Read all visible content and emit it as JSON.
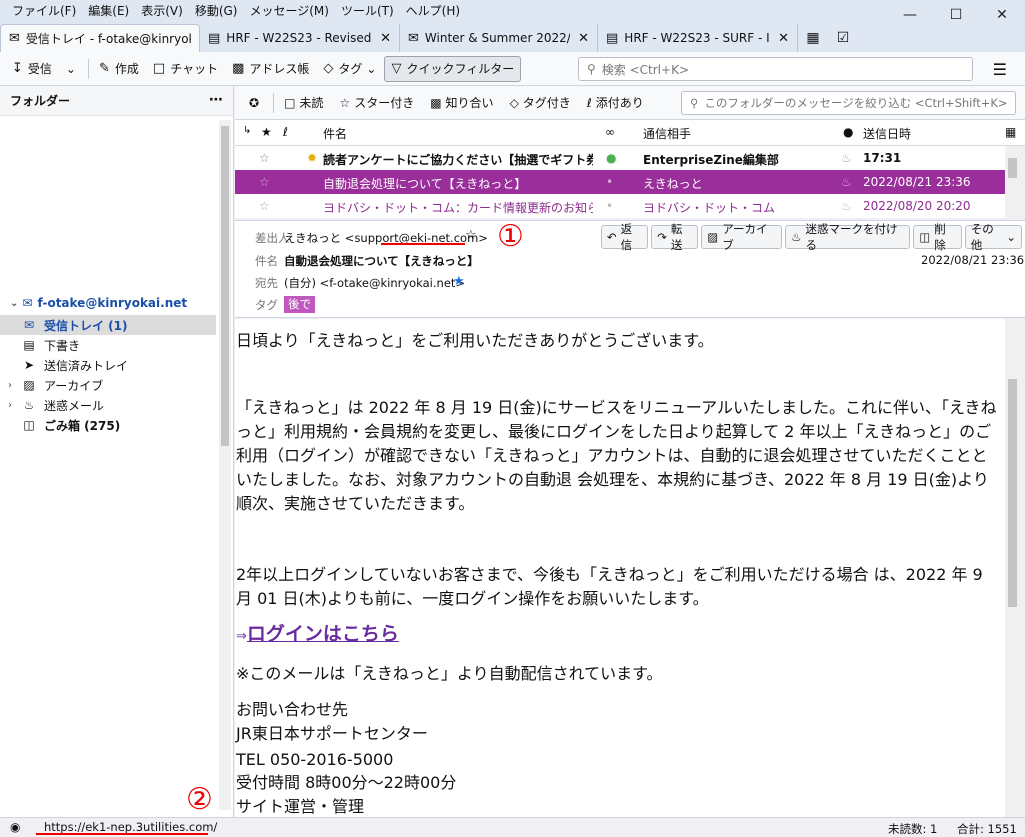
{
  "menu": [
    "ファイル(F)",
    "編集(E)",
    "表示(V)",
    "移動(G)",
    "メッセージ(M)",
    "ツール(T)",
    "ヘルプ(H)"
  ],
  "tabs": [
    {
      "label": "受信トレイ - f-otake@kinryokai",
      "icon": "inbox-icon",
      "active": true
    },
    {
      "label": "HRF - W22S23 - Revised -",
      "icon": "document-icon",
      "active": false
    },
    {
      "label": "Winter & Summer 2022/ 2",
      "icon": "mail-icon",
      "active": false
    },
    {
      "label": "HRF - W22S23 - SURF - IN",
      "icon": "document-icon",
      "active": false
    }
  ],
  "toolbar": {
    "receive": "受信",
    "compose": "作成",
    "chat": "チャット",
    "addressbook": "アドレス帳",
    "tag": "タグ",
    "quickfilter": "クイックフィルター",
    "search_placeholder": "検索 <Ctrl+K>"
  },
  "folders": {
    "header": "フォルダー",
    "account": "f-otake@kinryokai.net",
    "items": [
      {
        "label": "受信トレイ (1)",
        "icon": "inbox-icon",
        "selected": true
      },
      {
        "label": "下書き",
        "icon": "drafts-icon",
        "selected": false
      },
      {
        "label": "送信済みトレイ",
        "icon": "sent-icon",
        "selected": false
      },
      {
        "label": "アーカイブ",
        "icon": "archive-icon",
        "selected": false
      },
      {
        "label": "迷惑メール",
        "icon": "junk-icon",
        "selected": false
      },
      {
        "label": "ごみ箱 (275)",
        "icon": "trash-icon",
        "selected": false
      }
    ]
  },
  "quickfilter": {
    "unread": "未読",
    "starred": "スター付き",
    "contacts": "知り合い",
    "tagged": "タグ付き",
    "attachment": "添付あり",
    "search_placeholder": "このフォルダーのメッセージを絞り込む <Ctrl+Shift+K>"
  },
  "columns": {
    "subject": "件名",
    "correspondent": "通信相手",
    "date": "送信日時"
  },
  "messages": [
    {
      "subject": "読者アンケートにご協力ください【抽選でギフト券5千円...",
      "from": "EnterpriseZine編集部",
      "date": "17:31"
    },
    {
      "subject": "自動退会処理について【えきねっと】",
      "from": "えきねっと",
      "date": "2022/08/21 23:36"
    },
    {
      "subject": "ヨドバシ・ドット・コム：カード情報更新のお知らせ",
      "from": "ヨドバシ・ドット・コム",
      "date": "2022/08/20 20:20"
    }
  ],
  "header": {
    "from_label": "差出人",
    "from_value": "えきねっと <support@eki-net.com>",
    "subject_label": "件名",
    "subject_value": "自動退会処理について【えきねっと】",
    "to_label": "宛先",
    "to_value": "(自分) <f-otake@kinryokai.net>",
    "tag_label": "タグ",
    "tag_value": "後で",
    "date": "2022/08/21 23:36",
    "buttons": {
      "reply": "返信",
      "forward": "転送",
      "archive": "アーカイブ",
      "junk": "迷惑マークを付ける",
      "delete": "削除",
      "other": "その他"
    }
  },
  "annotations": {
    "one": "①",
    "two": "②"
  },
  "body": {
    "p1": "日頃より「えきねっと」をご利用いただきありがとうございます。",
    "p2": "「えきねっと」は 2022 年 8 月 19 日(金)にサービスをリニューアルいたしました。これに伴い、「えきねっと」利用規約・会員規約を変更し、最後にログインをした日より起算して 2 年以上「えきねっと」のご利用（ログイン）が確認できない「えきねっと」アカウントは、自動的に退会処理させていただくことといたしました。なお、対象アカウントの自動退 会処理を、本規約に基づき、2022 年 8 月 19 日(金)より順次、実施させていただきます。",
    "p3": "2年以上ログインしていないお客さまで、今後も「えきねっと」をご利用いただける場合 は、2022 年 9 月 01 日(木)よりも前に、一度ログイン操作をお願いいたします。",
    "arrow": "⇒",
    "login_link": "ログインはこちら",
    "p4": "※このメールは「えきねっと」より自動配信されています。",
    "p5": "お問い合わせ先",
    "p6": "JR東日本サポートセンター",
    "p7": "TEL 050-2016-5000",
    "p8": "受付時間 8時00分～22時00分",
    "p9": "サイト運営・管理"
  },
  "status": {
    "url": "https://ek1-nep.3utilities.com/",
    "unread": "未読数: 1",
    "total": "合計: 1551"
  },
  "colors": {
    "accent": "#1a4ea8",
    "selected_row": "#9a2e9a",
    "annotation": "#e00000"
  }
}
